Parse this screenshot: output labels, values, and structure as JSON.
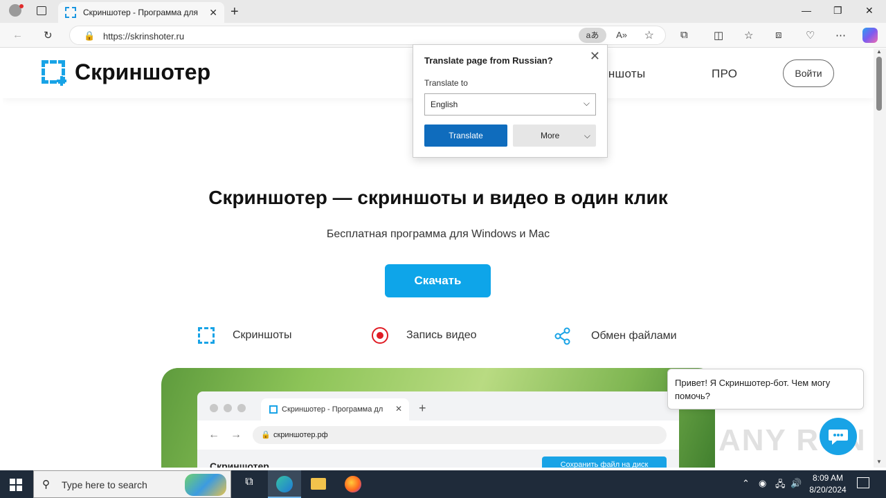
{
  "browser": {
    "tab_title": "Скриншотер - Программа для",
    "url": "https://skrinshoter.ru",
    "translate_badge": "aあ"
  },
  "site": {
    "logo_text": "Скриншотер",
    "nav": [
      "Скриншоты",
      "ПРО"
    ],
    "login": "Войти",
    "hero_title": "Скриншотер — скриншоты и видео в один клик",
    "hero_subtitle": "Бесплатная программа для Windows и Mac",
    "download": "Скачать",
    "features": [
      {
        "label": "Скриншоты",
        "icon": "screenshot-icon"
      },
      {
        "label": "Запись видео",
        "icon": "record-icon"
      },
      {
        "label": "Обмен файлами",
        "icon": "share-icon"
      }
    ],
    "preview": {
      "tab_title": "Скриншотер - Программа дл",
      "url": "скриншотер.рф",
      "logo": "Скриншотер",
      "save_button": "Сохранить файл на диск"
    },
    "chat_message": "Привет! Я Скриншотер-бот. Чем могу помочь?",
    "watermark": "ANY RUN"
  },
  "translate_popup": {
    "title": "Translate page from Russian?",
    "label": "Translate to",
    "selected_language": "English",
    "translate_button": "Translate",
    "more_button": "More"
  },
  "taskbar": {
    "search_placeholder": "Type here to search",
    "time": "8:09 AM",
    "date": "8/20/2024"
  },
  "colors": {
    "accent": "#0ea5e9",
    "translate_button": "#0f6cbd",
    "record_red": "#e01b24"
  }
}
